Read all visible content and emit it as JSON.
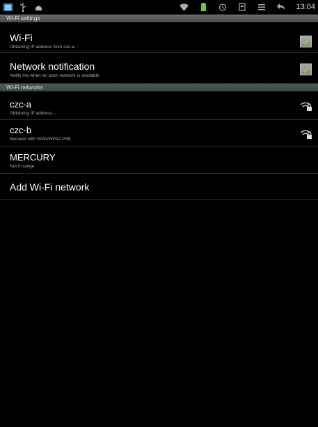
{
  "status_bar": {
    "time": "13:04",
    "left_icons": [
      "app-notification-icon",
      "usb-icon",
      "android-debug-icon"
    ],
    "right_icons": [
      "wifi-icon",
      "battery-icon",
      "alarm-icon",
      "storage-icon",
      "menu-icon",
      "back-icon"
    ]
  },
  "sections": {
    "wifi_settings": "Wi-Fi settings",
    "wifi_networks": "Wi-Fi networks"
  },
  "settings": [
    {
      "title": "Wi-Fi",
      "subtitle": "Obtaining IP address from czc-a...",
      "checked": true
    },
    {
      "title": "Network notification",
      "subtitle": "Notify me when an open network is available",
      "checked": true
    }
  ],
  "networks": [
    {
      "name": "czc-a",
      "status": "Obtaining IP address...",
      "signal_icon": "wifi-lock-icon"
    },
    {
      "name": "czc-b",
      "status": "Secured with WPA/WPA2 PSK",
      "signal_icon": "wifi-lock-icon"
    },
    {
      "name": "MERCURY",
      "status": "Not in range",
      "signal_icon": ""
    }
  ],
  "add_network": "Add Wi-Fi network",
  "colors": {
    "background": "#000000",
    "section_header": "#5a5a5a",
    "check_green": "#7fd13b",
    "divider": "#2c2c2c"
  }
}
